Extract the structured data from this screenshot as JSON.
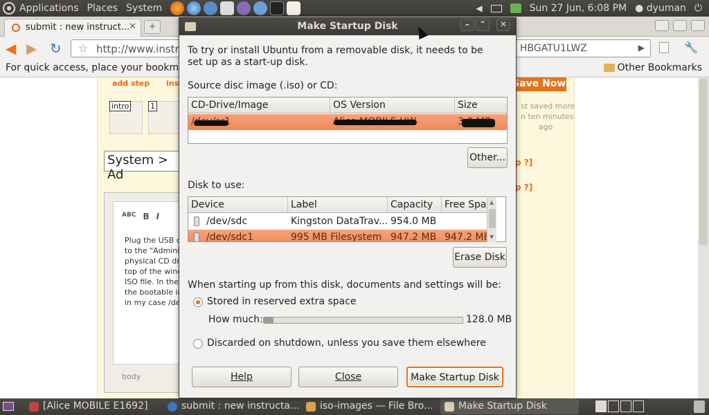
{
  "top_panel": {
    "menus": [
      "Applications",
      "Places",
      "System"
    ],
    "clock": "Sun 27 Jun,  6:08 PM",
    "user": "dyuman"
  },
  "browser": {
    "tab_title": "submit : new instruct...",
    "url": "http://www.instru",
    "url_tail": "HBGATU1LWZ",
    "bookmark_hint": "For quick access, place your bookmark",
    "other_bookmarks": "Other Bookmarks",
    "page": {
      "add_step": "add step",
      "insert": "ins",
      "thumb_intro": "intro",
      "thumb_1": "1",
      "title_value": "System > Ad",
      "editor_buttons": [
        "ABC",
        "B",
        "I"
      ],
      "editor_text": "Plug the USB d\nto the \"Adminis\nphysical CD dr\ntop of the wind\nISO file. In the\nthe bootable in\nin my case /de",
      "editor_footer": "body",
      "save_now": "Save Now",
      "saved_text": "st saved more\nn ten minutes\nago",
      "help_links": [
        "p ?]",
        "p ?]"
      ]
    }
  },
  "dialog": {
    "title": "Make Startup Disk",
    "intro": "To try or install Ubuntu from a removable disk, it needs to be set up as a start-up disk.",
    "source_label": "Source disc image (.iso) or CD:",
    "source_columns": [
      "CD-Drive/Image",
      "OS Version",
      "Size"
    ],
    "source_rows": [
      {
        "image": "/dev/sr1",
        "os_version": "Alice MOBILE HW",
        "size": "3.0 MB"
      }
    ],
    "other_button": "Other...",
    "disk_label": "Disk to use:",
    "disk_columns": [
      "Device",
      "Label",
      "Capacity",
      "Free Space"
    ],
    "disk_rows": [
      {
        "device": "/dev/sdc",
        "label": "Kingston DataTrav...",
        "capacity": "954.0 MB",
        "free": ""
      },
      {
        "device": "/dev/sdc1",
        "label": "995 MB Filesystem",
        "capacity": "947.2 MB",
        "free": "947.2 MB"
      }
    ],
    "erase_button": "Erase Disk",
    "startup_label": "When starting up from this disk, documents and settings will be:",
    "option_stored": "Stored in reserved extra space",
    "how_much_label": "How much:",
    "how_much_value": "128.0 MB",
    "how_much_fraction": 0.05,
    "option_discarded": "Discarded on shutdown, unless you save them elsewhere",
    "help_button": "Help",
    "close_button": "Close",
    "make_button": "Make Startup Disk"
  },
  "taskbar": {
    "tasks": [
      "[Alice MOBILE E1692]",
      "submit : new instructa...",
      "iso-images — File Bro...",
      "Make Startup Disk"
    ]
  },
  "colors": {
    "accent": "#e8711c",
    "selection": "#f08858",
    "panel": "#3c3b37"
  }
}
